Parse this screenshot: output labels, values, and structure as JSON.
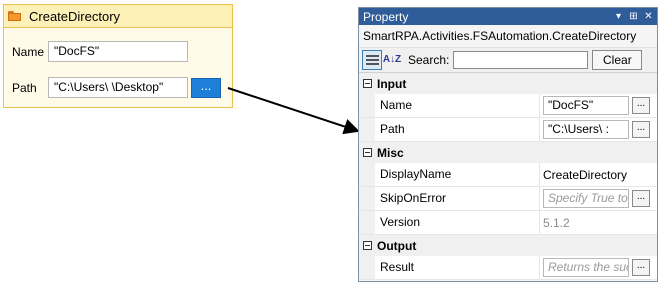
{
  "activity": {
    "title": "CreateDirectory",
    "name_label": "Name",
    "name_value": "\"DocFS\"",
    "path_label": "Path",
    "path_value": "\"C:\\Users\\            \\Desktop\"",
    "browse_label": "..."
  },
  "panel": {
    "title": "Property",
    "title_controls": [
      "▾",
      "⊞",
      "✕"
    ],
    "type_name": "SmartRPA.Activities.FSAutomation.CreateDirectory",
    "search_label": "Search:",
    "search_value": "",
    "clear_label": "Clear",
    "categorized_icon": "categorized-icon",
    "alphabetical_icon": "alphabetical-icon",
    "sort_glyph": "A↓Z"
  },
  "categories": [
    {
      "label": "Input",
      "props": [
        {
          "name": "Name",
          "value": "\"DocFS\"",
          "style": "box",
          "has_button": true
        },
        {
          "name": "Path",
          "value": "\"C:\\Users\\       :",
          "style": "box",
          "has_button": true
        }
      ]
    },
    {
      "label": "Misc",
      "props": [
        {
          "name": "DisplayName",
          "value": "CreateDirectory",
          "style": "plain",
          "has_button": false
        },
        {
          "name": "SkipOnError",
          "value": "Specify True to ...",
          "style": "italic",
          "has_button": true
        },
        {
          "name": "Version",
          "value": "5.1.2",
          "style": "grey",
          "has_button": false
        }
      ]
    },
    {
      "label": "Output",
      "props": [
        {
          "name": "Result",
          "value": "Returns the succ",
          "style": "italic",
          "has_button": true
        }
      ]
    }
  ],
  "colors": {
    "panel_title_bg": "#2f5d9a",
    "activity_border": "#e8c24a",
    "browse_button": "#1e7fd8"
  }
}
